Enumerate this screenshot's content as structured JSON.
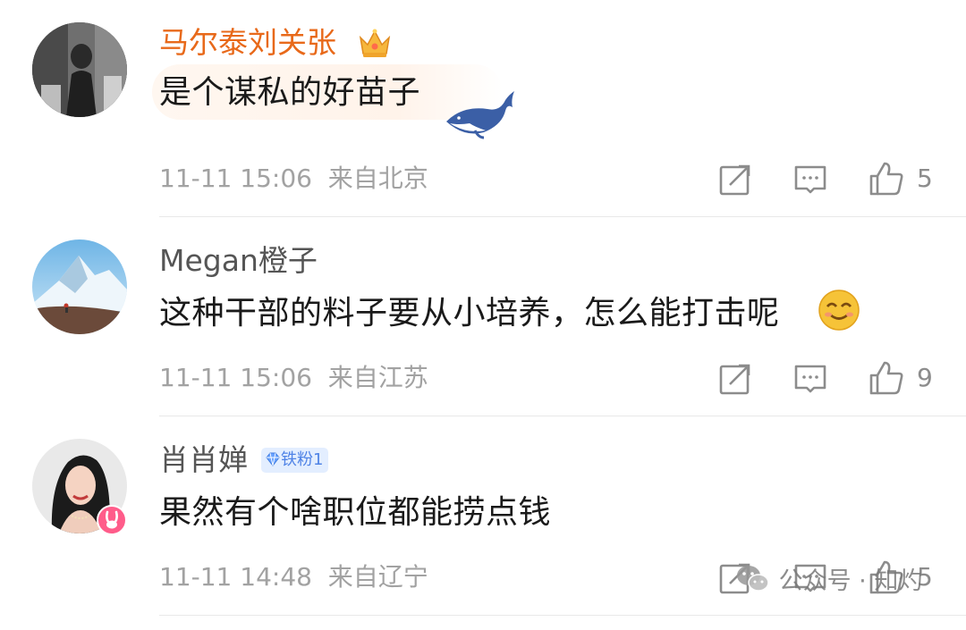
{
  "colors": {
    "vip_name": "#e8691a",
    "name": "#555555",
    "meta": "#a2a2a2",
    "badge_bg": "#e3eeff",
    "badge_text": "#4f83e6"
  },
  "comments": [
    {
      "username": "马尔泰刘关张",
      "text": "是个谋私的好苗子",
      "time": "11-11 15:06",
      "location": "来自北京",
      "likes": "5"
    },
    {
      "username": "Megan橙子",
      "text": "这种干部的料子要从小培养，怎么能打击呢",
      "time": "11-11 15:06",
      "location": "来自江苏",
      "likes": "9"
    },
    {
      "username": "肖肖婵",
      "badge": "铁粉1",
      "text": "果然有个啥职位都能捞点钱",
      "time": "11-11 14:48",
      "location": "来自辽宁",
      "likes": "5"
    }
  ],
  "icons": [
    "crown-icon",
    "whale-icon",
    "smile-emoji-icon",
    "diamond-icon",
    "rabbit-badge-icon",
    "repost-icon",
    "reply-icon",
    "like-icon",
    "wechat-icon"
  ],
  "watermark": {
    "text": "公众号 · 知灼"
  }
}
